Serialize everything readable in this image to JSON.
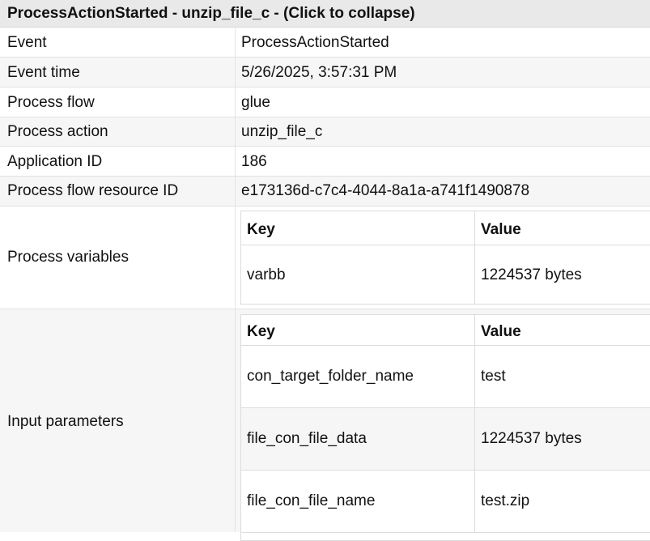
{
  "header": {
    "title": "ProcessActionStarted - unzip_file_c - (Click to collapse)"
  },
  "rows": [
    {
      "label": "Event",
      "value": "ProcessActionStarted"
    },
    {
      "label": "Event time",
      "value": "5/26/2025, 3:57:31 PM"
    },
    {
      "label": "Process flow",
      "value": "glue"
    },
    {
      "label": "Process action",
      "value": "unzip_file_c"
    },
    {
      "label": "Application ID",
      "value": "186"
    },
    {
      "label": "Process flow resource ID",
      "value": "e173136d-c7c4-4044-8a1a-a741f1490878"
    }
  ],
  "process_variables": {
    "label": "Process variables",
    "key_header": "Key",
    "value_header": "Value",
    "items": [
      {
        "key": "varbb",
        "value": "1224537 bytes"
      }
    ]
  },
  "input_parameters": {
    "label": "Input parameters",
    "key_header": "Key",
    "value_header": "Value",
    "items": [
      {
        "key": "con_target_folder_name",
        "value": "test"
      },
      {
        "key": "file_con_file_data",
        "value": "1224537 bytes"
      },
      {
        "key": "file_con_file_name",
        "value": "test.zip"
      }
    ]
  }
}
